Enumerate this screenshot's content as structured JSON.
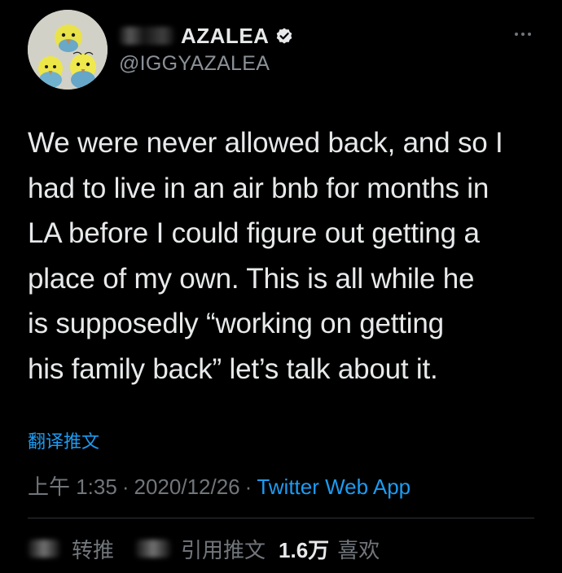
{
  "author": {
    "display_name": "AZALEA",
    "handle": "@IGGYAZALEA"
  },
  "tweet": {
    "lines": [
      "We were never allowed back, and so I",
      "had to live in an air bnb for months in",
      "LA before I could figure out getting a",
      "place of my own. This is all while he",
      "is supposedly “working on getting",
      "his family back” let’s talk about it."
    ]
  },
  "translate_label": "翻译推文",
  "meta": {
    "time": "上午 1:35",
    "separator": "·",
    "date": "2020/12/26",
    "source": "Twitter Web App"
  },
  "stats": {
    "retweets_label": "转推",
    "quotes_label": "引用推文",
    "likes_count": "1.6万",
    "likes_label": "喜欢"
  },
  "icons": {
    "verified": "verified-badge-icon",
    "more": "more-horizontal-icon",
    "avatar": "budgerigar-avatar"
  },
  "colors": {
    "background": "#000000",
    "text": "#e7e9ea",
    "muted": "#71767b",
    "accent": "#1d9bf0"
  }
}
